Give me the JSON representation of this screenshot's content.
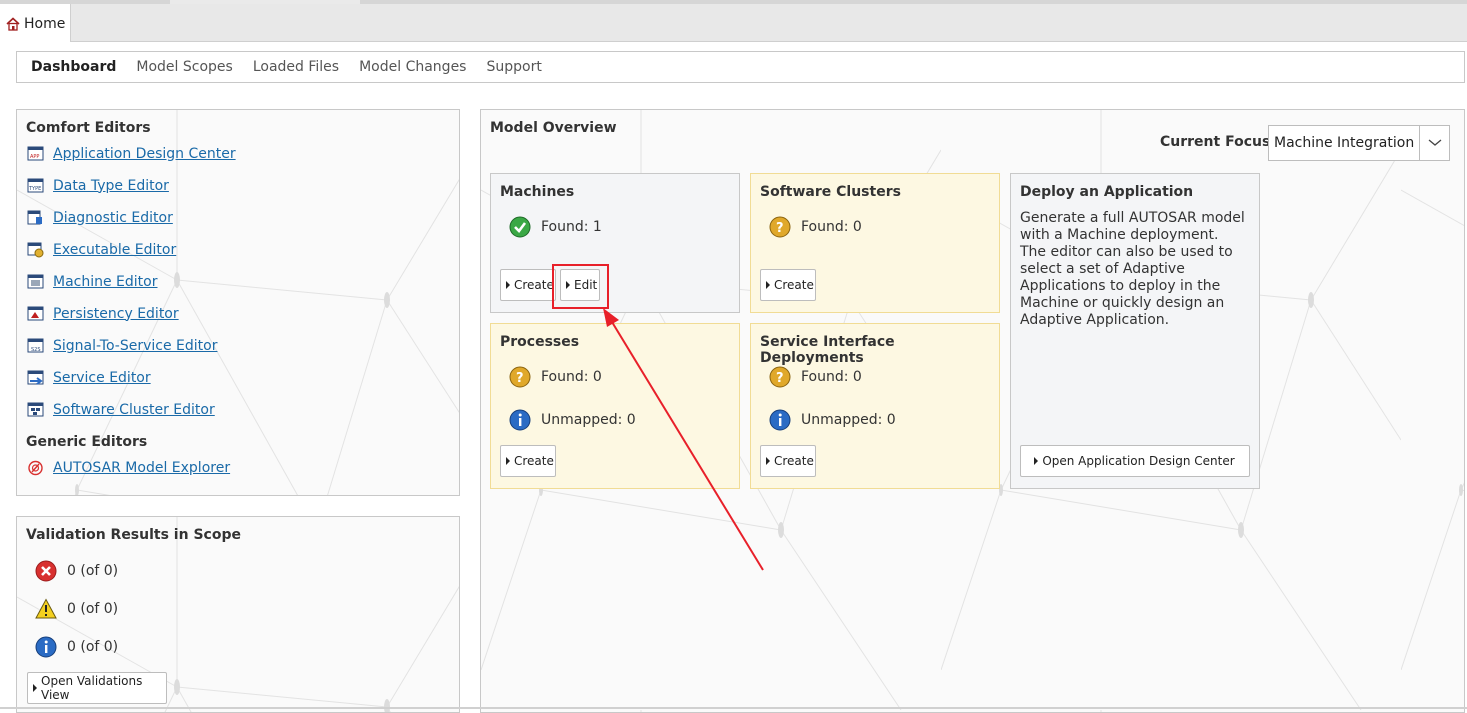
{
  "tabs": [
    {
      "label": "Home",
      "icon": "home-icon"
    }
  ],
  "nav": {
    "items": [
      {
        "label": "Dashboard",
        "active": true
      },
      {
        "label": "Model Scopes",
        "active": false
      },
      {
        "label": "Loaded Files",
        "active": false
      },
      {
        "label": "Model Changes",
        "active": false
      },
      {
        "label": "Support",
        "active": false
      }
    ]
  },
  "comfort_editors": {
    "title": "Comfort Editors",
    "items": [
      {
        "label": "Application Design Center",
        "icon": "application-design-center-icon"
      },
      {
        "label": "Data Type Editor",
        "icon": "data-type-editor-icon"
      },
      {
        "label": "Diagnostic Editor",
        "icon": "diagnostic-editor-icon"
      },
      {
        "label": "Executable Editor",
        "icon": "executable-editor-icon"
      },
      {
        "label": "Machine Editor",
        "icon": "machine-editor-icon"
      },
      {
        "label": "Persistency Editor",
        "icon": "persistency-editor-icon"
      },
      {
        "label": "Signal-To-Service Editor",
        "icon": "signal-to-service-editor-icon"
      },
      {
        "label": "Service Editor",
        "icon": "service-editor-icon"
      },
      {
        "label": "Software Cluster Editor",
        "icon": "software-cluster-editor-icon"
      }
    ],
    "generic_title": "Generic Editors",
    "generic_items": [
      {
        "label": "AUTOSAR Model Explorer",
        "icon": "autosar-model-explorer-icon"
      }
    ]
  },
  "validation": {
    "title": "Validation Results in Scope",
    "errors": "0 (of 0)",
    "warnings": "0 (of 0)",
    "infos": "0 (of 0)",
    "button": "Open Validations View"
  },
  "overview": {
    "title": "Model Overview",
    "focus_label": "Current Focus:",
    "focus_value": "Machine Integration",
    "machines": {
      "title": "Machines",
      "found": "Found: 1",
      "create": "Create",
      "edit": "Edit"
    },
    "software_clusters": {
      "title": "Software Clusters",
      "found": "Found: 0",
      "create": "Create"
    },
    "processes": {
      "title": "Processes",
      "found": "Found: 0",
      "unmapped": "Unmapped: 0",
      "create": "Create"
    },
    "service_interface_deployments": {
      "title": "Service Interface Deployments",
      "found": "Found: 0",
      "unmapped": "Unmapped: 0",
      "create": "Create"
    },
    "deploy": {
      "title": "Deploy an Application",
      "lines": [
        "Generate a full AUTOSAR model",
        "with a Machine deployment.",
        "The editor can also be used to",
        "select a set of Adaptive",
        "Applications to deploy in the",
        "Machine or quickly design an",
        "Adaptive Application."
      ],
      "button": "Open Application Design Center"
    }
  },
  "colors": {
    "link": "#1a6aa8",
    "highlight": "#e8202a",
    "ok_green": "#3aa845",
    "warn_gold": "#e0a82a",
    "info_blue": "#2a6bc4",
    "error_red": "#d8302f"
  }
}
